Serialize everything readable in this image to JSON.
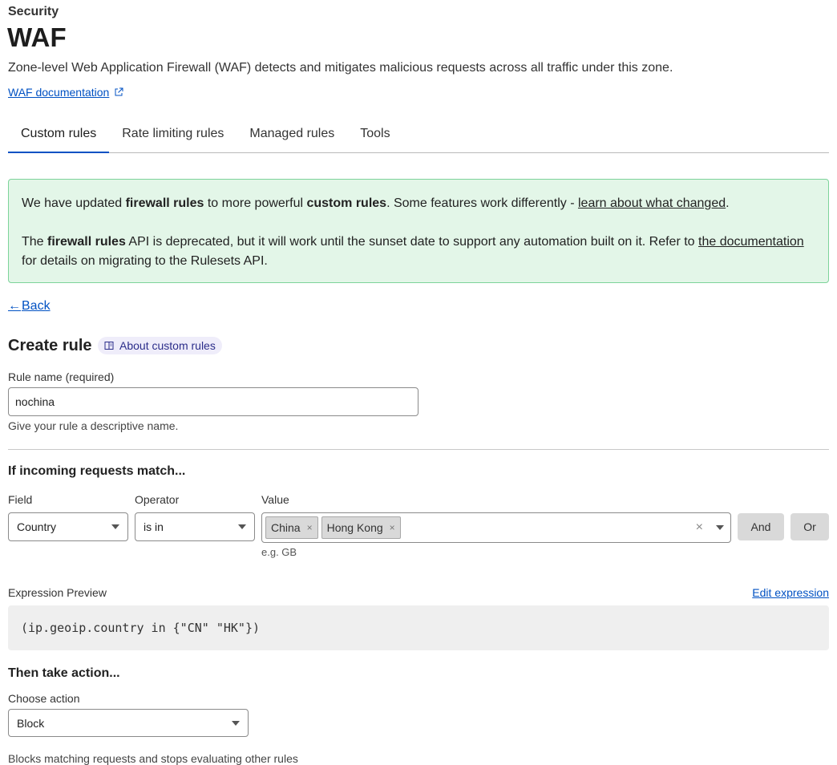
{
  "header": {
    "section": "Security",
    "title": "WAF",
    "description": "Zone-level Web Application Firewall (WAF) detects and mitigates malicious requests across all traffic under this zone.",
    "doc_link": "WAF documentation"
  },
  "tabs": [
    {
      "label": "Custom rules",
      "active": true
    },
    {
      "label": "Rate limiting rules",
      "active": false
    },
    {
      "label": "Managed rules",
      "active": false
    },
    {
      "label": "Tools",
      "active": false
    }
  ],
  "notice": {
    "p1_a": "We have updated ",
    "p1_b": "firewall rules",
    "p1_c": " to more powerful ",
    "p1_d": "custom rules",
    "p1_e": ". Some features work differently - ",
    "p1_link": "learn about what changed",
    "p1_end": ".",
    "p2_a": "The ",
    "p2_b": "firewall rules",
    "p2_c": " API is deprecated, but it will work until the sunset date to support any automation built on it. Refer to ",
    "p2_link": "the documentation",
    "p2_d": " for details on migrating to the Rulesets API."
  },
  "back": {
    "arrow": "←",
    "label": "Back"
  },
  "create": {
    "title": "Create rule",
    "about": "About custom rules",
    "rule_name_label": "Rule name (required)",
    "rule_name_value": "nochina",
    "rule_name_help": "Give your rule a descriptive name."
  },
  "match": {
    "title": "If incoming requests match...",
    "field_label": "Field",
    "field_value": "Country",
    "operator_label": "Operator",
    "operator_value": "is in",
    "value_label": "Value",
    "values": [
      "China",
      "Hong Kong"
    ],
    "chip_remove": "×",
    "clear": "×",
    "value_help": "e.g. GB",
    "and": "And",
    "or": "Or"
  },
  "expression": {
    "label": "Expression Preview",
    "edit": "Edit expression",
    "code": "(ip.geoip.country in {\"CN\" \"HK\"})"
  },
  "action": {
    "title": "Then take action...",
    "choose_label": "Choose action",
    "value": "Block",
    "help": "Blocks matching requests and stops evaluating other rules"
  }
}
